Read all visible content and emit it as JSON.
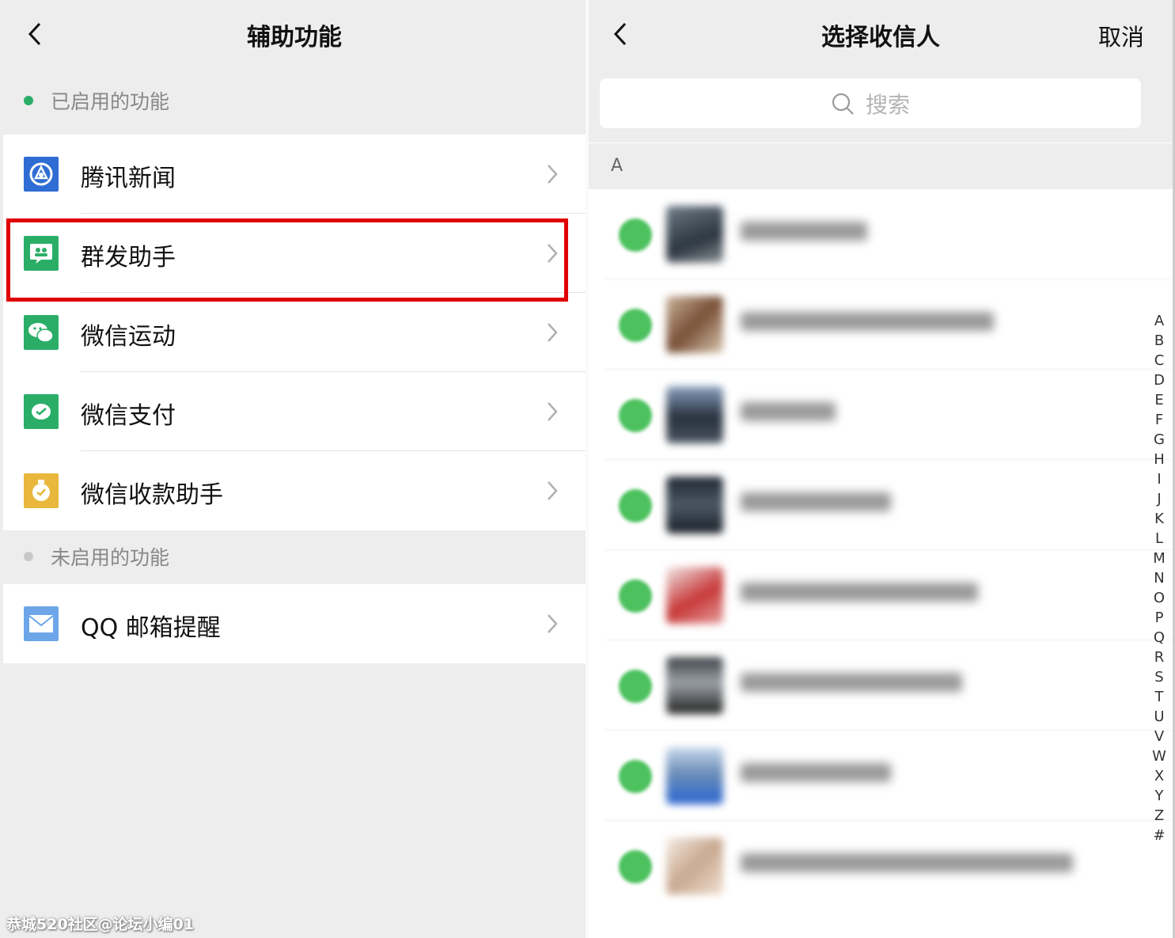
{
  "left": {
    "title": "辅助功能",
    "enabled_header": "已启用的功能",
    "disabled_header": "未启用的功能",
    "enabled_items": [
      {
        "label": "腾讯新闻",
        "icon": "tencent-news-icon",
        "color": "#2f6dd4"
      },
      {
        "label": "群发助手",
        "icon": "group-send-icon",
        "color": "#2aae67"
      },
      {
        "label": "微信运动",
        "icon": "wechat-sport-icon",
        "color": "#2aae67"
      },
      {
        "label": "微信支付",
        "icon": "wechat-pay-icon",
        "color": "#2aae67"
      },
      {
        "label": "微信收款助手",
        "icon": "receipt-assistant-icon",
        "color": "#e8b73c"
      }
    ],
    "disabled_items": [
      {
        "label": "QQ 邮箱提醒",
        "icon": "qq-mail-icon",
        "color": "#6da6e8"
      }
    ],
    "highlight_color": "#e00000"
  },
  "right": {
    "title": "选择收信人",
    "cancel": "取消",
    "search_placeholder": "搜索",
    "section_letter": "A",
    "index_letters": [
      "A",
      "B",
      "C",
      "D",
      "E",
      "F",
      "G",
      "H",
      "I",
      "J",
      "K",
      "L",
      "M",
      "N",
      "O",
      "P",
      "Q",
      "R",
      "S",
      "T",
      "U",
      "V",
      "W",
      "X",
      "Y",
      "Z",
      "#"
    ]
  },
  "watermark": "恭城520社区@论坛小编01",
  "colors": {
    "accent_green": "#4cc15e",
    "background": "#ededed"
  }
}
